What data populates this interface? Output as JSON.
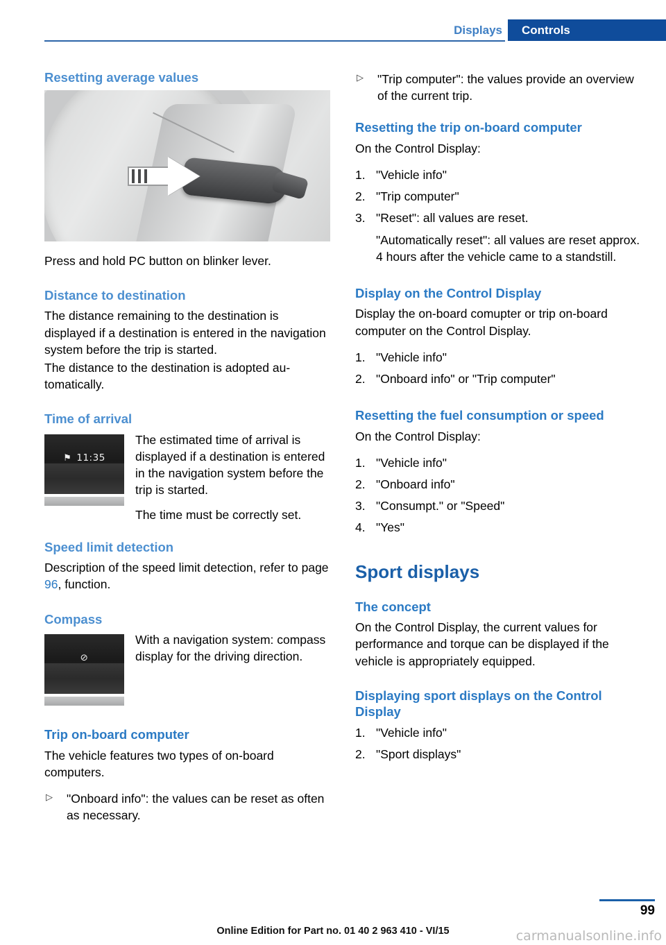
{
  "header": {
    "tab_displays": "Displays",
    "tab_controls": "Controls"
  },
  "left": {
    "h_resetting_average": "Resetting average values",
    "caption_press_hold": "Press and hold PC button on blinker lever.",
    "h_distance": "Distance to destination",
    "p_distance_1": "The distance remaining to the destination is displayed if a destination is entered in the navi­gation system before the trip is started.",
    "p_distance_2": "The distance to the destination is adopted au­tomatically.",
    "h_time_arrival": "Time of arrival",
    "display_time_icon": "compass-glyph",
    "display_time_value": "11:35",
    "p_time_1": "The estimated time of arrival is displayed if a destination is en­tered in the navigation system before the trip is started.",
    "p_time_2": "The time must be correctly set.",
    "h_speed_limit": "Speed limit detection",
    "p_speed_limit_a": "Description of the speed limit detection, refer to page ",
    "p_speed_limit_page": "96",
    "p_speed_limit_b": ", function.",
    "h_compass": "Compass",
    "display_compass_glyph": "⊘",
    "p_compass": "With a navigation system: com­pass display for the driving di­rection.",
    "h_trip_obc": "Trip on-board computer",
    "p_trip_obc": "The vehicle features two types of on-board computers.",
    "bullet_onboard_info": "\"Onboard info\": the values can be reset as often as necessary."
  },
  "right": {
    "bullet_trip_computer": "\"Trip computer\": the values provide an overview of the current trip.",
    "h_resetting_trip": "Resetting the trip on-board computer",
    "p_on_control_display_1": "On the Control Display:",
    "list_reset": [
      "\"Vehicle info\"",
      "\"Trip computer\"",
      "\"Reset\": all values are reset."
    ],
    "list_reset_3_sub": "\"Automatically reset\": all values are reset approx. 4 hours after the vehicle came to a standstill.",
    "h_display_on_cd": "Display on the Control Display",
    "p_display_on_cd": "Display the on-board comupter or trip on-board computer on the Control Display.",
    "list_display": [
      "\"Vehicle info\"",
      "\"Onboard info\" or \"Trip computer\""
    ],
    "h_resetting_fuel": "Resetting the fuel consumption or speed",
    "p_on_control_display_2": "On the Control Display:",
    "list_fuel": [
      "\"Vehicle info\"",
      "\"Onboard info\"",
      "\"Consumpt.\" or \"Speed\"",
      "\"Yes\""
    ],
    "h_sport_displays": "Sport displays",
    "h_the_concept": "The concept",
    "p_the_concept": "On the Control Display, the current values for performance and torque can be displayed if the vehicle is appropriately equipped.",
    "h_displaying_sport": "Displaying sport displays on the Control Display",
    "list_sport": [
      "\"Vehicle info\"",
      "\"Sport displays\""
    ]
  },
  "footer": {
    "page_number": "99",
    "edition_line": "Online Edition for Part no. 01 40 2 963 410 - VI/15",
    "watermark": "carmanualsonline.info"
  }
}
